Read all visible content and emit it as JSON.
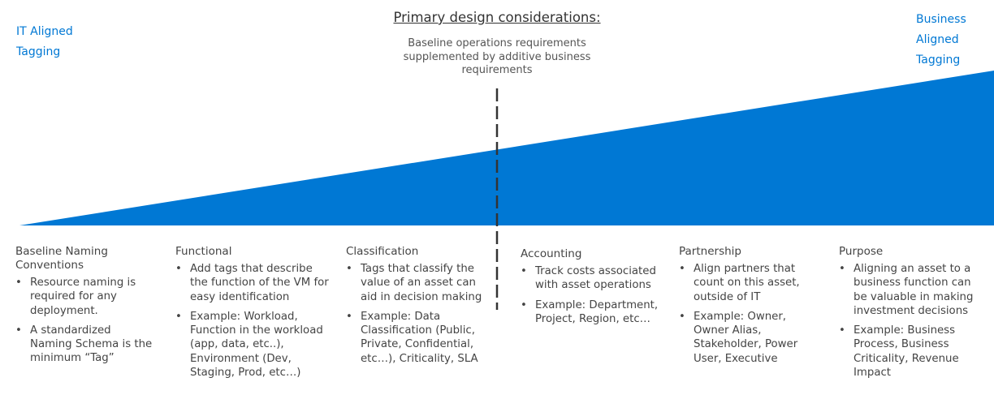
{
  "left_label": [
    "IT Aligned",
    "Tagging"
  ],
  "right_label": [
    "Business",
    "Aligned",
    "Tagging"
  ],
  "title": "Primary design considerations:",
  "subtitle": "Baseline operations requirements supplemented by additive business requirements",
  "colors": {
    "accent": "#0078d4",
    "text": "#444444",
    "divider": "#333333"
  },
  "bullet_glyph": "•",
  "columns": [
    {
      "heading": "Baseline Naming Conventions",
      "bullets": [
        "Resource naming is required for any deployment.",
        "A standardized Naming Schema is the minimum “Tag”"
      ]
    },
    {
      "heading": "Functional",
      "bullets": [
        "Add tags that describe the function of the VM for easy identification",
        "Example: Workload, Function in the workload (app, data, etc..), Environment (Dev, Staging, Prod, etc…)"
      ]
    },
    {
      "heading": "Classification",
      "bullets": [
        "Tags that classify the value of an asset can aid in decision making",
        "Example: Data Classification (Public, Private, Confidential, etc…), Criticality, SLA"
      ]
    },
    {
      "heading": "Accounting",
      "bullets": [
        "Track costs associated with asset operations",
        "Example: Department, Project, Region, etc…"
      ]
    },
    {
      "heading": "Partnership",
      "bullets": [
        "Align partners that count on this asset, outside of IT",
        "Example: Owner, Owner Alias, Stakeholder, Power User, Executive"
      ]
    },
    {
      "heading": "Purpose",
      "bullets": [
        "Aligning an asset to a business function can be valuable in making investment decisions",
        "Example: Business Process, Business Criticality, Revenue Impact"
      ]
    }
  ]
}
